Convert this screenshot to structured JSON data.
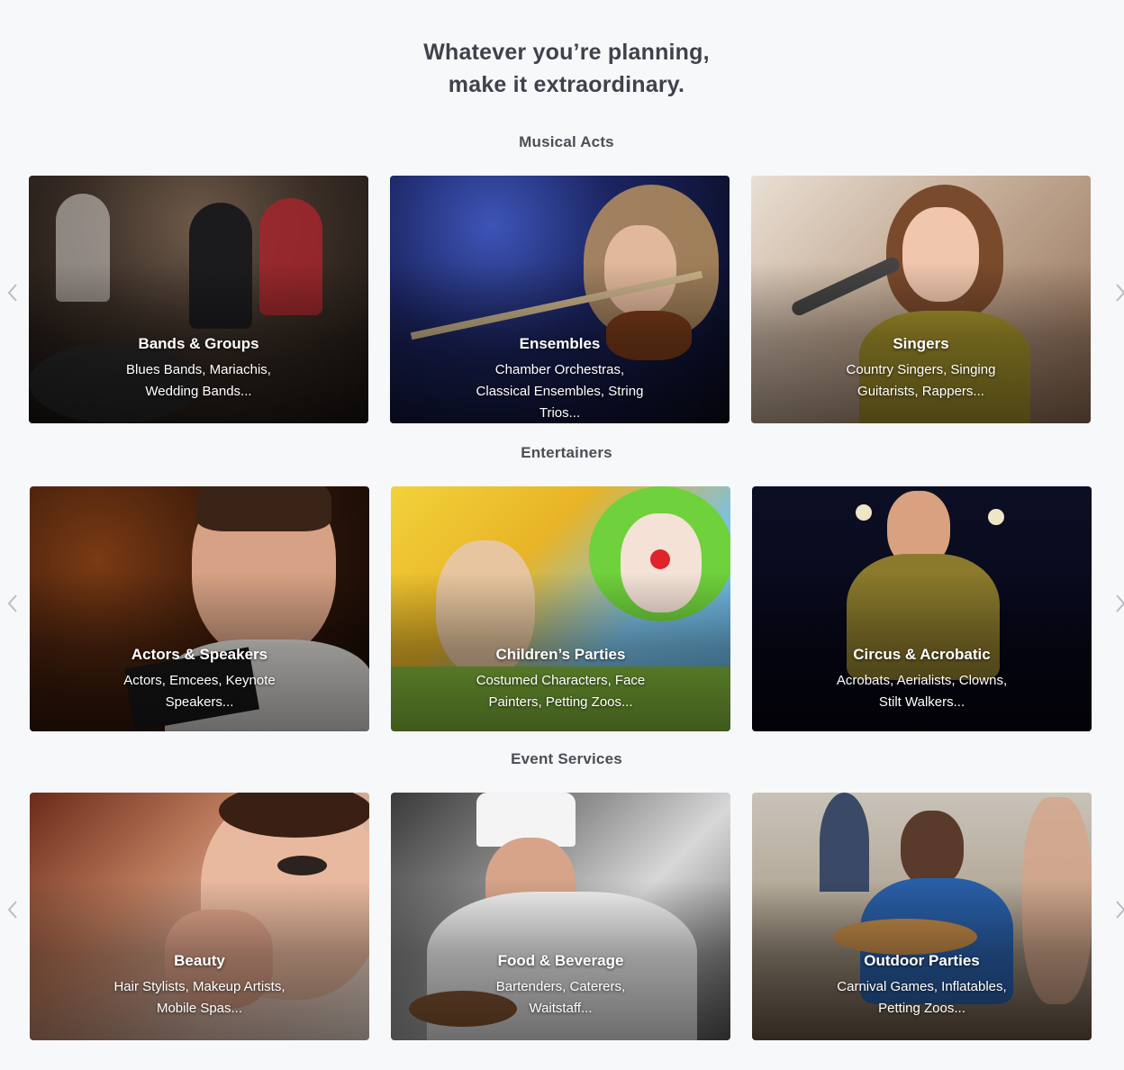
{
  "headline": {
    "line1": "Whatever you’re planning,",
    "line2": "make it extraordinary."
  },
  "sections": [
    {
      "title": "Musical Acts",
      "cards": [
        {
          "title": "Bands & Groups",
          "desc": "Blues Bands, Mariachis, Wedding Bands..."
        },
        {
          "title": "Ensembles",
          "desc": "Chamber Orchestras, Classical Ensembles, String Trios..."
        },
        {
          "title": "Singers",
          "desc": "Country Singers, Singing Guitarists, Rappers..."
        }
      ]
    },
    {
      "title": "Entertainers",
      "cards": [
        {
          "title": "Actors & Speakers",
          "desc": "Actors, Emcees, Keynote Speakers..."
        },
        {
          "title": "Children’s Parties",
          "desc": "Costumed Characters, Face Painters, Petting Zoos..."
        },
        {
          "title": "Circus & Acrobatic",
          "desc": "Acrobats, Aerialists, Clowns, Stilt Walkers..."
        }
      ]
    },
    {
      "title": "Event Services",
      "cards": [
        {
          "title": "Beauty",
          "desc": "Hair Stylists, Makeup Artists, Mobile Spas..."
        },
        {
          "title": "Food & Beverage",
          "desc": "Bartenders, Caterers, Waitstaff..."
        },
        {
          "title": "Outdoor Parties",
          "desc": "Carnival Games, Inflatables, Petting Zoos..."
        }
      ]
    }
  ],
  "icons": {
    "prev": "chevron-left-icon",
    "next": "chevron-right-icon"
  },
  "colors": {
    "background": "#f7f8fa",
    "heading": "#3e4249",
    "arrow": "#b9bcc2"
  }
}
